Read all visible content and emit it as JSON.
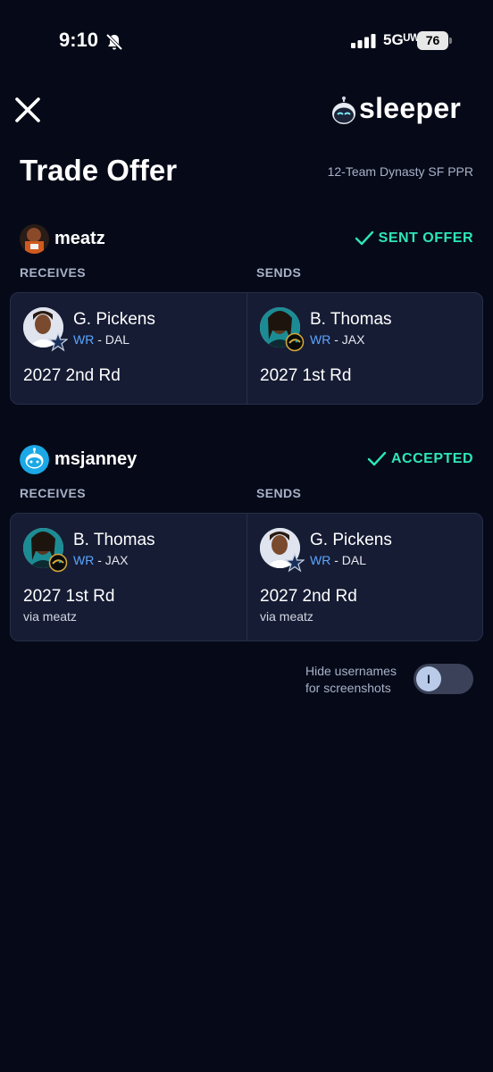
{
  "status_bar": {
    "time": "9:10",
    "network": "5Gᵁᵂ",
    "battery": "76"
  },
  "header": {
    "logo_text": "sleeper",
    "title": "Trade Offer",
    "league": "12-Team Dynasty SF PPR"
  },
  "trades": [
    {
      "username": "meatz",
      "status": "SENT OFFER",
      "receives_label": "RECEIVES",
      "sends_label": "SENDS",
      "receives": {
        "player_name": "G. Pickens",
        "position": "WR",
        "team_text": " - DAL",
        "pick": "2027 2nd Rd",
        "note": ""
      },
      "sends": {
        "player_name": "B. Thomas",
        "position": "WR",
        "team_text": " - JAX",
        "pick": "2027 1st Rd",
        "note": ""
      }
    },
    {
      "username": "msjanney",
      "status": "ACCEPTED",
      "receives_label": "RECEIVES",
      "sends_label": "SENDS",
      "receives": {
        "player_name": "B. Thomas",
        "position": "WR",
        "team_text": " - JAX",
        "pick": "2027 1st Rd",
        "note": "via meatz"
      },
      "sends": {
        "player_name": "G. Pickens",
        "position": "WR",
        "team_text": " - DAL",
        "pick": "2027 2nd Rd",
        "note": "via meatz"
      }
    }
  ],
  "footer": {
    "hide_usernames_label": "Hide usernames for screenshots",
    "toggle_glyph": "I"
  },
  "colors": {
    "background": "#060a18",
    "card": "#161c34",
    "accent_green": "#2ee6b8",
    "position_blue": "#5ba6ff"
  },
  "icons": [
    "mute-icon",
    "signal-icon",
    "battery-icon",
    "close-icon",
    "sleeper-logo-icon",
    "check-icon",
    "dallas-star-icon",
    "jaguars-icon"
  ]
}
